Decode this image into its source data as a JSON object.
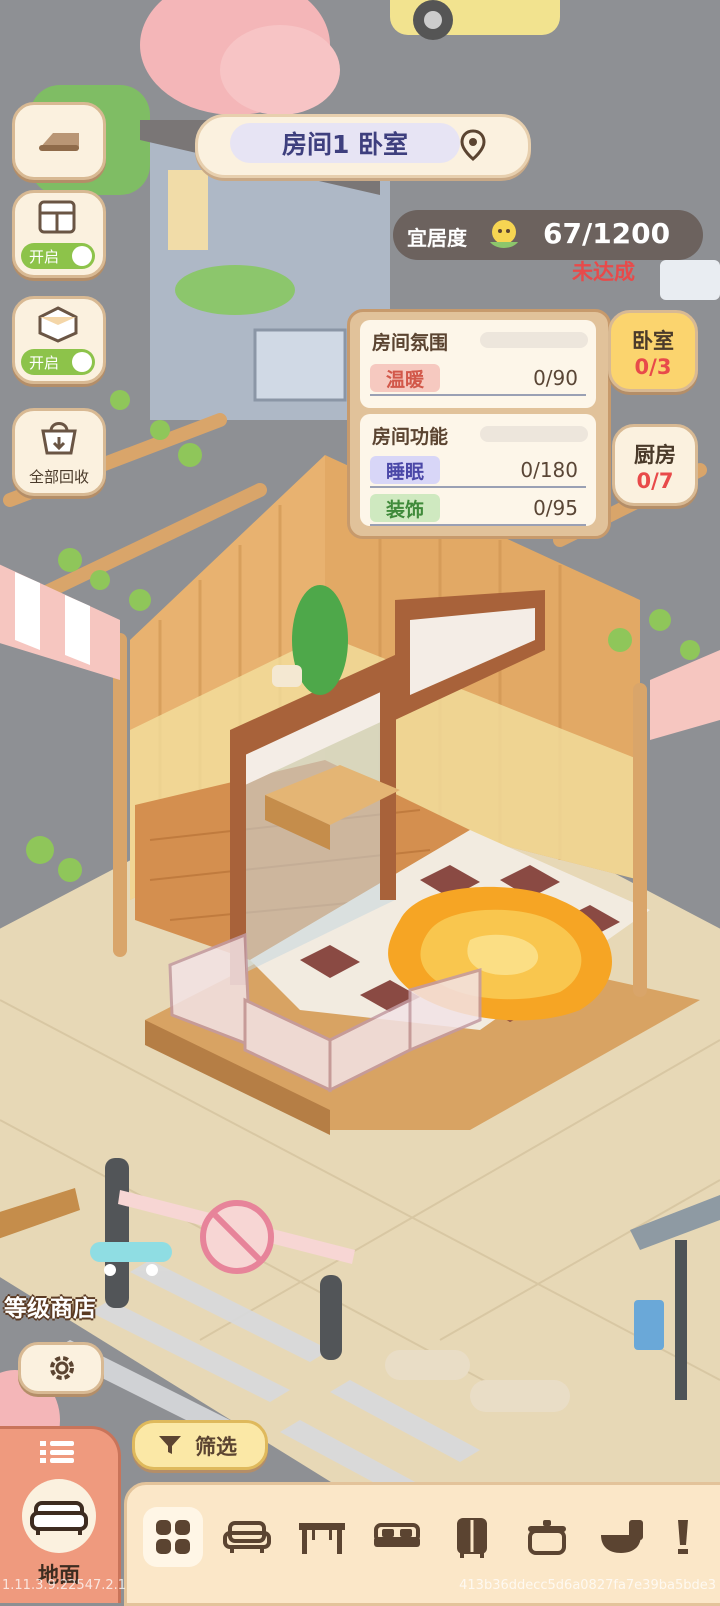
{
  "header": {
    "room_title": "房间1 卧室",
    "livability_label": "宜居度",
    "livability_value": "67/1200",
    "livability_status": "未达成"
  },
  "left_controls": {
    "toggle1_label": "开启",
    "toggle2_label": "开启",
    "recycle_label": "全部回收"
  },
  "room_info": {
    "atmosphere_title": "房间氛围",
    "atmosphere_stats": [
      {
        "label": "温暖",
        "value": "0/90"
      }
    ],
    "function_title": "房间功能",
    "function_stats": [
      {
        "label": "睡眠",
        "value": "0/180"
      },
      {
        "label": "装饰",
        "value": "0/95"
      }
    ]
  },
  "room_tabs": [
    {
      "name": "卧室",
      "count": "0/3"
    },
    {
      "name": "厨房",
      "count": "0/7"
    }
  ],
  "bottom": {
    "shop_label": "等级商店",
    "filter_label": "筛选",
    "ground_label": "地面",
    "version": "1.11.3.9.22547.2.1",
    "build_hash": "413b36ddecc5d6a0827fa7e39ba5bde3"
  },
  "colors": {
    "warm_chip": "#f6c9c0",
    "sleep_chip": "#d8d6f7",
    "decor_chip": "#cfe9c0",
    "status_red": "#e84a4a"
  },
  "icons": [
    "back-icon",
    "wall-icon",
    "floor-icon",
    "recycle-basket-icon",
    "location-pin-icon",
    "flower-face-icon",
    "gear-icon",
    "filter-icon",
    "list-icon",
    "sofa-icon",
    "grid-icon",
    "armchair-icon",
    "table-icon",
    "bed-icon",
    "wardrobe-icon",
    "pot-icon",
    "toilet-icon"
  ]
}
